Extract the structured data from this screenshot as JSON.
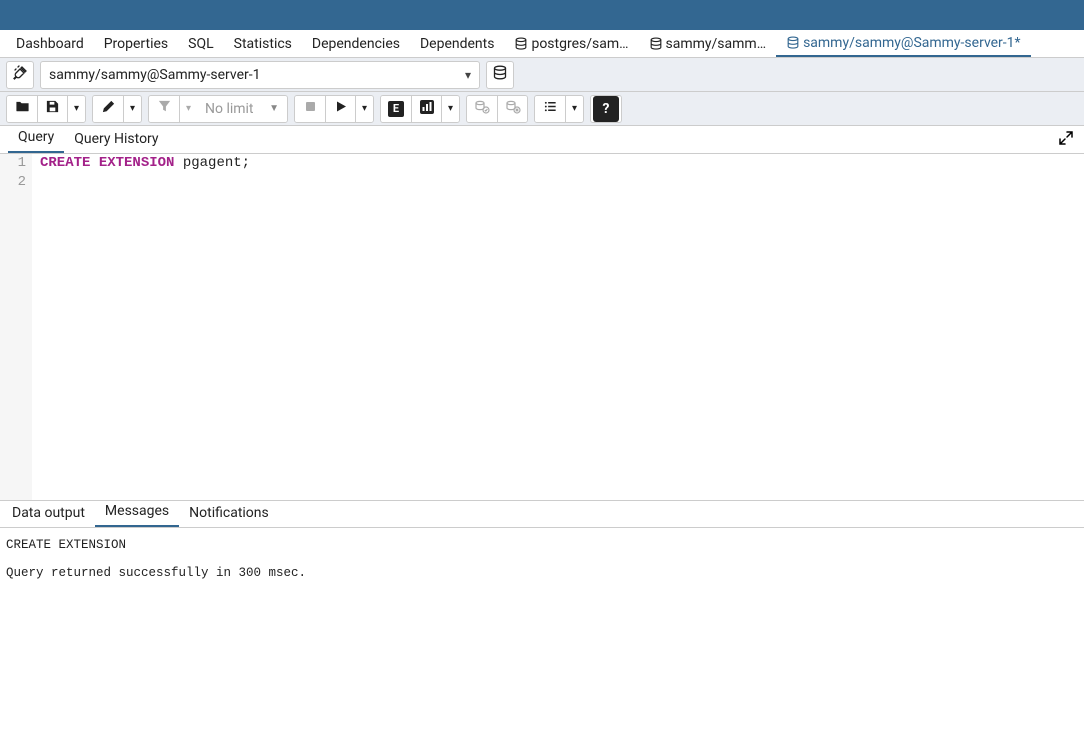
{
  "nav": {
    "tabs": [
      {
        "label": "Dashboard"
      },
      {
        "label": "Properties"
      },
      {
        "label": "SQL"
      },
      {
        "label": "Statistics"
      },
      {
        "label": "Dependencies"
      },
      {
        "label": "Dependents"
      },
      {
        "label": "postgres/sam…",
        "hasIcon": true
      },
      {
        "label": "sammy/samm…",
        "hasIcon": true
      },
      {
        "label": "sammy/sammy@Sammy-server-1*",
        "hasIcon": true,
        "active": true
      }
    ]
  },
  "conn": {
    "selected": "sammy/sammy@Sammy-server-1"
  },
  "toolbar": {
    "limit_label": "No limit"
  },
  "editor_tabs": {
    "query": "Query",
    "history": "Query History"
  },
  "editor": {
    "lines": [
      "1",
      "2"
    ],
    "kw1": "CREATE",
    "kw2": "EXTENSION",
    "rest": " pgagent;"
  },
  "output_tabs": {
    "data": "Data output",
    "messages": "Messages",
    "notifications": "Notifications"
  },
  "messages": "CREATE EXTENSION\n\nQuery returned successfully in 300 msec."
}
